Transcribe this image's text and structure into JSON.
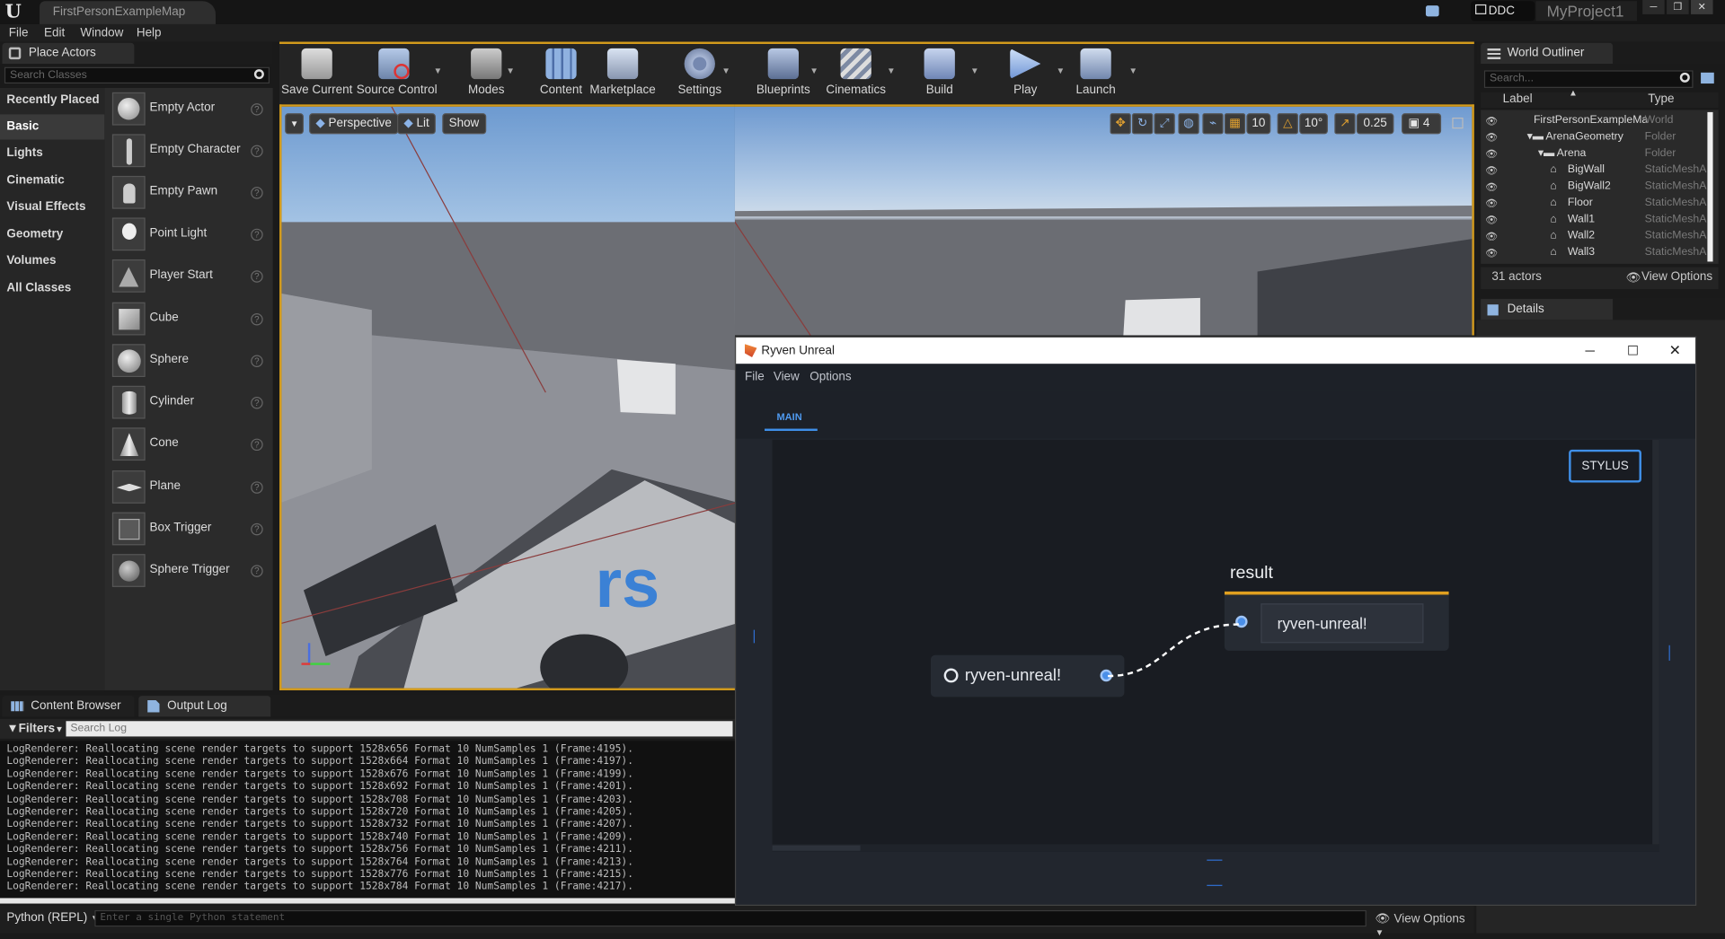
{
  "titlebar": {
    "map_tab": "FirstPersonExampleMap",
    "ddc": "DDC",
    "project": "MyProject1"
  },
  "menubar": [
    "File",
    "Edit",
    "Window",
    "Help"
  ],
  "place_actors": {
    "tab": "Place Actors",
    "search_placeholder": "Search Classes",
    "categories": [
      "Recently Placed",
      "Basic",
      "Lights",
      "Cinematic",
      "Visual Effects",
      "Geometry",
      "Volumes",
      "All Classes"
    ],
    "selected_category": "Basic",
    "items": [
      "Empty Actor",
      "Empty Character",
      "Empty Pawn",
      "Point Light",
      "Player Start",
      "Cube",
      "Sphere",
      "Cylinder",
      "Cone",
      "Plane",
      "Box Trigger",
      "Sphere Trigger"
    ]
  },
  "toolbar": {
    "buttons": [
      "Save Current",
      "Source Control",
      "Modes",
      "Content",
      "Marketplace",
      "Settings",
      "Blueprints",
      "Cinematics",
      "Build",
      "Play",
      "Launch"
    ]
  },
  "viewport": {
    "perspective": "Perspective",
    "lit": "Lit",
    "show": "Show",
    "grid_snap": "10",
    "rot_snap": "10°",
    "scale_snap": "0.25",
    "cam_speed": "4"
  },
  "world_outliner": {
    "tab": "World Outliner",
    "search_placeholder": "Search...",
    "col_label": "Label",
    "col_type": "Type",
    "rows": [
      {
        "label": "FirstPersonExampleMa",
        "type": "World",
        "indent": 0
      },
      {
        "label": "ArenaGeometry",
        "type": "Folder",
        "indent": 1
      },
      {
        "label": "Arena",
        "type": "Folder",
        "indent": 2
      },
      {
        "label": "BigWall",
        "type": "StaticMeshA",
        "indent": 3
      },
      {
        "label": "BigWall2",
        "type": "StaticMeshA",
        "indent": 3
      },
      {
        "label": "Floor",
        "type": "StaticMeshA",
        "indent": 3
      },
      {
        "label": "Wall1",
        "type": "StaticMeshA",
        "indent": 3
      },
      {
        "label": "Wall2",
        "type": "StaticMeshA",
        "indent": 3
      },
      {
        "label": "Wall3",
        "type": "StaticMeshA",
        "indent": 3
      }
    ],
    "actor_count": "31 actors",
    "view_options": "View Options"
  },
  "details": {
    "tab": "Details"
  },
  "bottom": {
    "content_browser_tab": "Content Browser",
    "output_log_tab": "Output Log",
    "filters": "Filters",
    "search_log_placeholder": "Search Log",
    "log_lines": [
      "LogRenderer: Reallocating scene render targets to support 1528x656 Format 10 NumSamples 1 (Frame:4195).",
      "LogRenderer: Reallocating scene render targets to support 1528x664 Format 10 NumSamples 1 (Frame:4197).",
      "LogRenderer: Reallocating scene render targets to support 1528x676 Format 10 NumSamples 1 (Frame:4199).",
      "LogRenderer: Reallocating scene render targets to support 1528x692 Format 10 NumSamples 1 (Frame:4201).",
      "LogRenderer: Reallocating scene render targets to support 1528x708 Format 10 NumSamples 1 (Frame:4203).",
      "LogRenderer: Reallocating scene render targets to support 1528x720 Format 10 NumSamples 1 (Frame:4205).",
      "LogRenderer: Reallocating scene render targets to support 1528x732 Format 10 NumSamples 1 (Frame:4207).",
      "LogRenderer: Reallocating scene render targets to support 1528x740 Format 10 NumSamples 1 (Frame:4209).",
      "LogRenderer: Reallocating scene render targets to support 1528x756 Format 10 NumSamples 1 (Frame:4211).",
      "LogRenderer: Reallocating scene render targets to support 1528x764 Format 10 NumSamples 1 (Frame:4213).",
      "LogRenderer: Reallocating scene render targets to support 1528x776 Format 10 NumSamples 1 (Frame:4215).",
      "LogRenderer: Reallocating scene render targets to support 1528x784 Format 10 NumSamples 1 (Frame:4217)."
    ],
    "python_mode": "Python (REPL)",
    "python_placeholder": "Enter a single Python statement",
    "view_options": "View Options"
  },
  "ryven": {
    "title": "Ryven Unreal",
    "menu": [
      "File",
      "View",
      "Options"
    ],
    "tab": "MAIN",
    "stylus_button": "STYLUS",
    "source_node_text": "ryven-unreal!",
    "result_node_title": "result",
    "result_node_value": "ryven-unreal!",
    "accent": "#3f8fe8",
    "result_accent": "#e0a020"
  }
}
